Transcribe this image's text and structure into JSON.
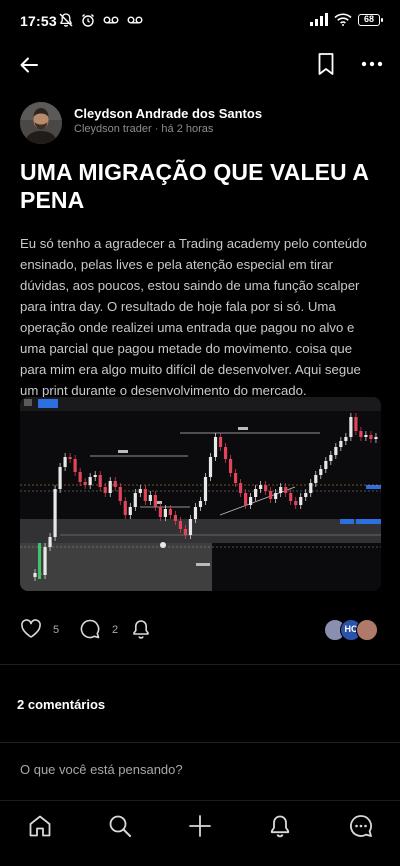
{
  "status_bar": {
    "time": "17:53",
    "battery": "68",
    "icons": [
      "mute-icon",
      "alarm-icon",
      "voicemail-icon",
      "voicemail-icon",
      "signal-icon",
      "wifi-icon",
      "battery-icon"
    ]
  },
  "top_bar": {
    "back_icon": "arrow-left-icon",
    "bookmark_icon": "bookmark-icon",
    "more_icon": "more-horizontal-icon"
  },
  "post": {
    "author_name": "Cleydson Andrade dos Santos",
    "author_meta": "Cleydson trader · há 2 horas",
    "title": "UMA MIGRAÇÃO QUE VALEU A PENA",
    "body": "Eu só tenho a agradecer a Trading academy pelo conteúdo ensinado, pelas lives e pela atenção especial em tirar dúvidas, aos poucos, estou saindo de uma função scalper para intra day. O resultado de hoje fala por si só. Uma operação onde realizei uma entrada que pagou no alvo e uma parcial que pagou metade do movimento. coisa que para mim era algo muito difícil de desenvolver. Aqui segue um print durante o desenvolvimento do mercado.",
    "likes": "5",
    "comments": "2",
    "participant_initials": "HC"
  },
  "comments": {
    "heading": "2 comentários",
    "placeholder": "O que você está pensando?"
  },
  "bottom_nav": {
    "items": [
      "home-icon",
      "search-icon",
      "plus-icon",
      "bell-icon",
      "chat-icon"
    ]
  },
  "colors": {
    "background": "#000000",
    "candle_up": "#e8e8e8",
    "candle_down": "#e0455a",
    "chart_green": "#3ec46d"
  }
}
